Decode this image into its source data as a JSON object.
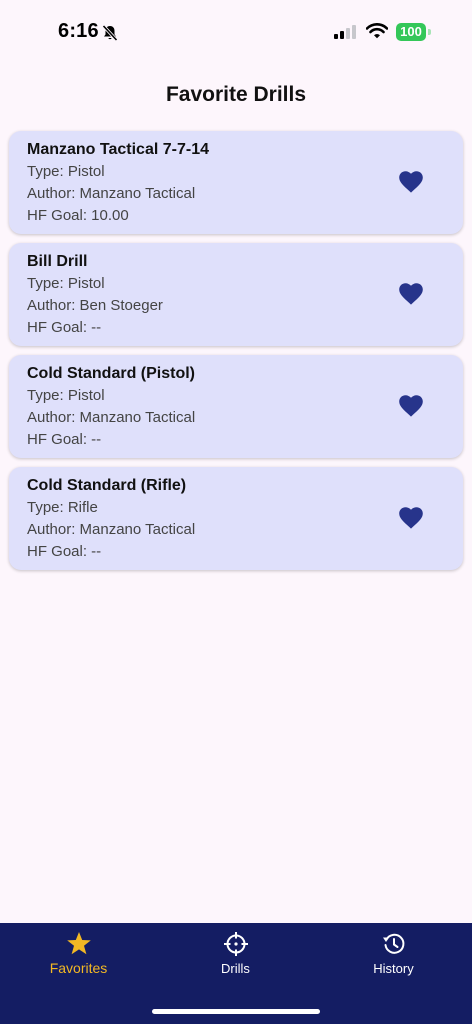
{
  "status_bar": {
    "time": "6:16",
    "battery": "100"
  },
  "header": {
    "title": "Favorite Drills"
  },
  "drills": [
    {
      "name": "Manzano Tactical 7-7-14",
      "type_line": "Type: Pistol",
      "author_line": "Author: Manzano Tactical",
      "goal_line": "HF Goal: 10.00"
    },
    {
      "name": "Bill Drill",
      "type_line": "Type: Pistol",
      "author_line": "Author: Ben Stoeger",
      "goal_line": "HF Goal: --"
    },
    {
      "name": "Cold Standard (Pistol)",
      "type_line": "Type: Pistol",
      "author_line": "Author: Manzano Tactical",
      "goal_line": "HF Goal: --"
    },
    {
      "name": "Cold Standard (Rifle)",
      "type_line": "Type: Rifle",
      "author_line": "Author: Manzano Tactical",
      "goal_line": "HF Goal: --"
    }
  ],
  "tabs": [
    {
      "label": "Favorites",
      "icon": "star-icon",
      "active": true
    },
    {
      "label": "Drills",
      "icon": "crosshair-icon",
      "active": false
    },
    {
      "label": "History",
      "icon": "history-icon",
      "active": false
    }
  ],
  "colors": {
    "background": "#fdf6fc",
    "card": "#dfe0fb",
    "heart": "#27348b",
    "tab_bar": "#141d63",
    "tab_active": "#f2b824",
    "tab_inactive": "#ffffff",
    "battery": "#34c759"
  }
}
